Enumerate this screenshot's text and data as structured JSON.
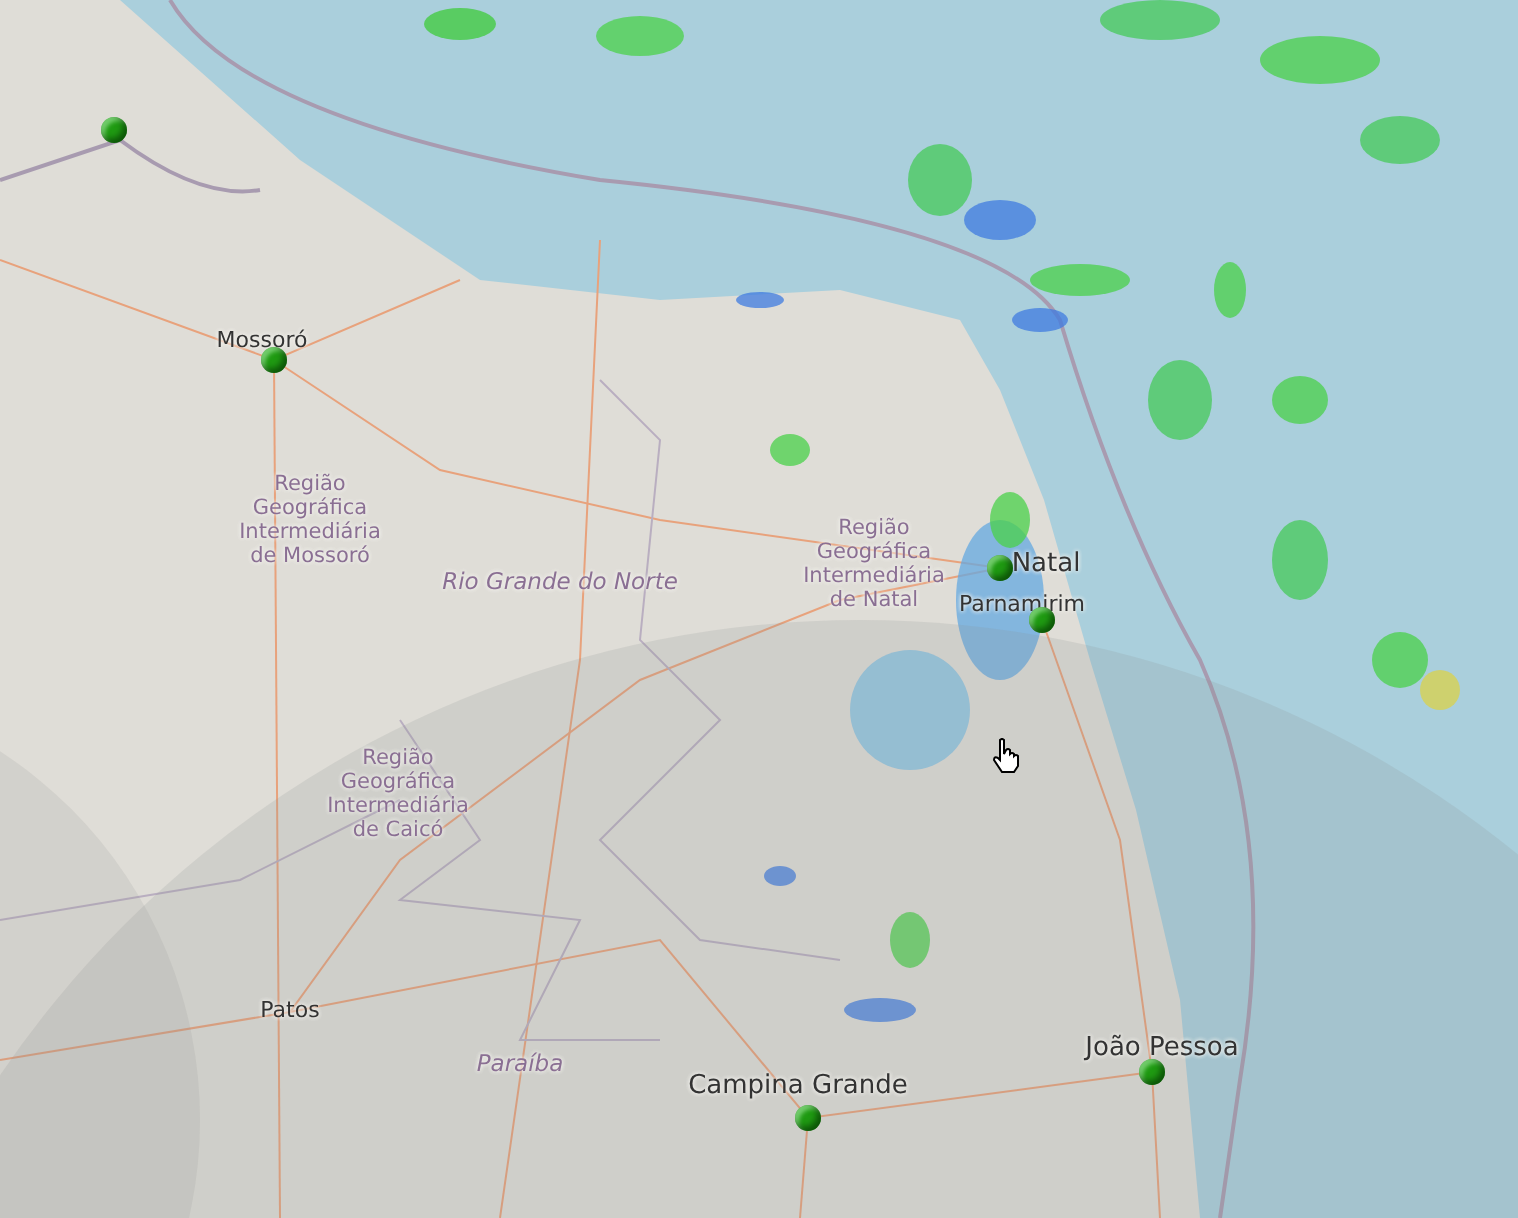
{
  "map": {
    "places": [
      {
        "kind": "city",
        "name": "Mossoró"
      },
      {
        "kind": "region",
        "lines": [
          "Região",
          "Geográfica",
          "Intermediária",
          "de Mossoró"
        ]
      },
      {
        "kind": "state",
        "name": "Rio Grande do Norte"
      },
      {
        "kind": "region",
        "lines": [
          "Região",
          "Geográfica",
          "Intermediária",
          "de Natal"
        ]
      },
      {
        "kind": "capital",
        "name": "Natal"
      },
      {
        "kind": "city",
        "name": "Parnamirim"
      },
      {
        "kind": "region",
        "lines": [
          "Região",
          "Geográfica",
          "Intermediária",
          "de Caicó"
        ]
      },
      {
        "kind": "city",
        "name": "Patos"
      },
      {
        "kind": "state",
        "name": "Paraíba"
      },
      {
        "kind": "capital",
        "name": "Campina Grande"
      },
      {
        "kind": "capital",
        "name": "João Pessoa"
      }
    ],
    "markers": [
      {
        "color": "#1f9a12"
      },
      {
        "color": "#1f9a12"
      },
      {
        "color": "#1f9a12"
      },
      {
        "color": "#1f9a12"
      },
      {
        "color": "#1f9a12"
      },
      {
        "color": "#1f9a12"
      }
    ]
  }
}
